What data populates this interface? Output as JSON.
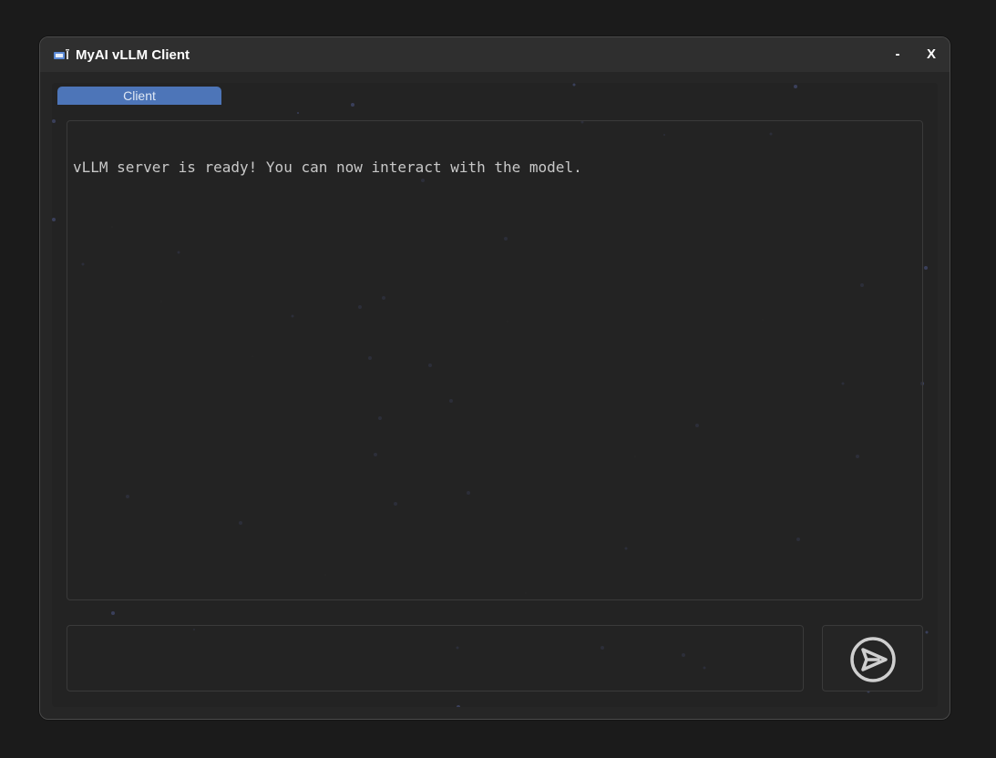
{
  "window": {
    "title": "MyAI vLLM Client",
    "minimize_label": "-",
    "close_label": "X",
    "icon": "app-window-icon"
  },
  "tabs": [
    {
      "label": "Client",
      "active": true
    }
  ],
  "output": {
    "text": "vLLM server is ready! You can now interact with the model."
  },
  "input": {
    "value": "",
    "placeholder": ""
  },
  "send_button": {
    "icon": "send-icon"
  },
  "colors": {
    "accent": "#4d75b8",
    "background": "#1b1b1b",
    "panel": "#262626",
    "text": "#c8c8c8"
  }
}
